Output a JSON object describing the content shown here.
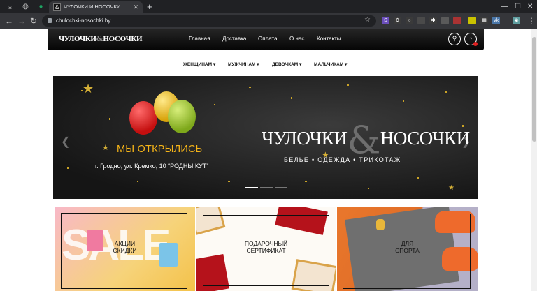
{
  "browser": {
    "tab_title": "ЧУЛОЧКИ И НОСОЧКИ",
    "tab_favicon": "&",
    "url": "chulochki-nosochki.by",
    "new_tab_glyph": "+",
    "close_glyph": "✕",
    "min_glyph": "—",
    "max_glyph": "☐"
  },
  "site": {
    "logo_left": "ЧУЛОЧКИ",
    "logo_amp": "&",
    "logo_right": "НОСОЧКИ",
    "nav": [
      "Главная",
      "Доставка",
      "Оплата",
      "О нас",
      "Контакты"
    ],
    "categories": [
      "ЖЕНЩИНАМ",
      "МУЖЧИНАМ",
      "ДЕВОЧКАМ",
      "МАЛЬЧИКАМ"
    ]
  },
  "banner": {
    "headline": "МЫ ОТКРЫЛИСЬ",
    "address": "г. Гродно, ул. Кремко, 10 “РОДНЫ КУТ”",
    "logo_left": "ЧУЛОЧКИ",
    "logo_amp": "&",
    "logo_right": "НОСОЧКИ",
    "tagline": "БЕЛЬЕ • ОДЕЖДА • ТРИКОТАЖ",
    "slides_total": 3,
    "active_slide": 1
  },
  "cards": [
    {
      "label": "АКЦИИ\nСКИДКИ",
      "bg_text": "SALE"
    },
    {
      "label": "ПОДАРОЧНЫЙ\nСЕРТИФИКАТ"
    },
    {
      "label": "ДЛЯ\nСПОРТА"
    }
  ],
  "colors": {
    "accent_gold": "#f5b418",
    "header_bg": "#111111",
    "browser_bg": "#202124"
  }
}
